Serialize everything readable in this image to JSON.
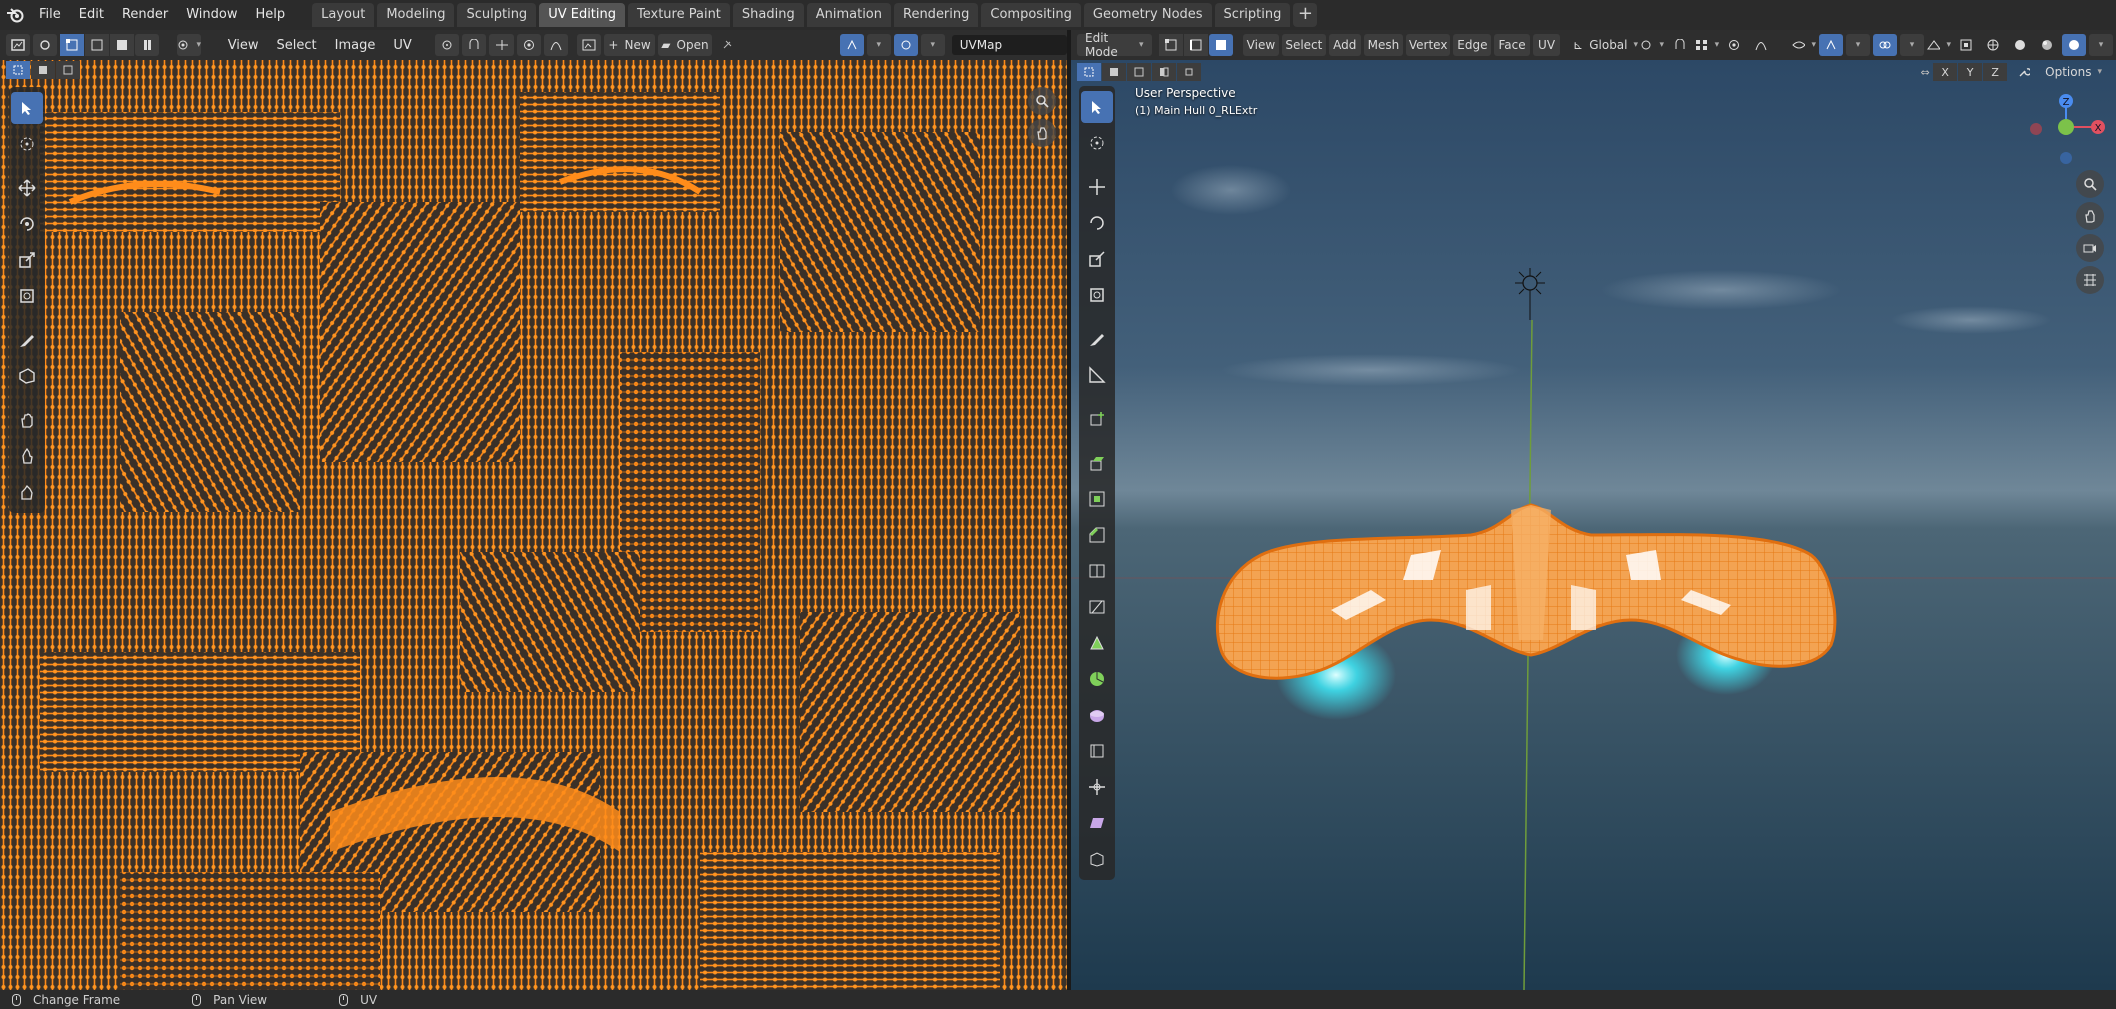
{
  "menubar": {
    "items": [
      "File",
      "Edit",
      "Render",
      "Window",
      "Help"
    ]
  },
  "workspaces": {
    "tabs": [
      "Layout",
      "Modeling",
      "Sculpting",
      "UV Editing",
      "Texture Paint",
      "Shading",
      "Animation",
      "Rendering",
      "Compositing",
      "Geometry Nodes",
      "Scripting"
    ],
    "active": "UV Editing",
    "add_label": "+"
  },
  "uv_editor": {
    "menus": [
      "View",
      "Select",
      "Image",
      "UV"
    ],
    "new_label": "New",
    "open_label": "Open",
    "uvmap_name": "UVMap",
    "mesh_color": "#ff8a1a"
  },
  "viewport": {
    "mode": "Edit Mode",
    "menus": [
      "View",
      "Select",
      "Add",
      "Mesh",
      "Vertex",
      "Edge",
      "Face",
      "UV"
    ],
    "orientation": "Global",
    "options_label": "Options",
    "axis_labels": [
      "X",
      "Y",
      "Z"
    ],
    "overlay_title": "User Perspective",
    "overlay_object": "(1) Main Hull 0_RLExtr",
    "mesh_color": "#f08a1c",
    "glow_color": "#3ff0ff"
  },
  "statusbar": {
    "items": [
      "Change Frame",
      "Pan View",
      "UV"
    ]
  }
}
